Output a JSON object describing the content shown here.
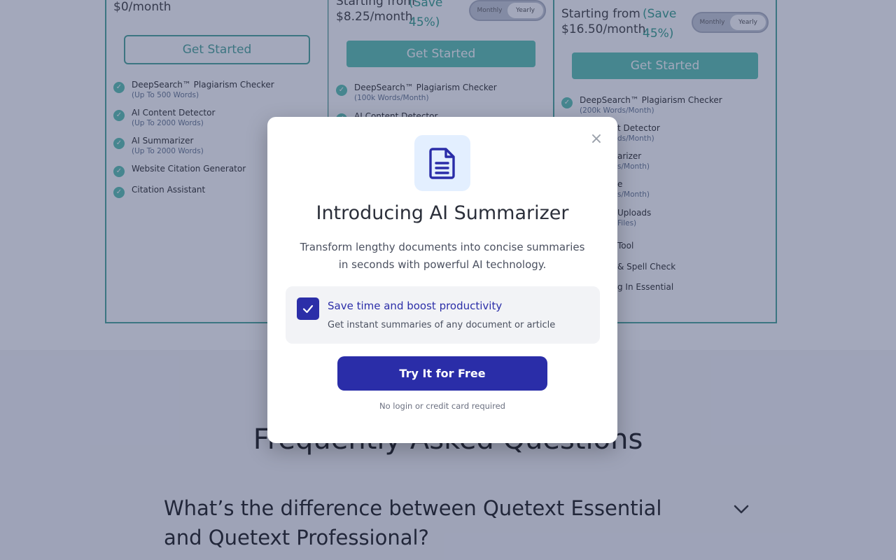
{
  "plans": [
    {
      "price": "$0/month",
      "button": "Get Started",
      "features": [
        {
          "title": "DeepSearch™ Plagiarism Checker",
          "sub": "(Up To 500 Words)"
        },
        {
          "title": "AI Content Detector",
          "sub": "(Up To 2000 Words)"
        },
        {
          "title": "AI Summarizer",
          "sub": "(Up To 2000 Words)"
        },
        {
          "title": "Website Citation Generator",
          "sub": ""
        },
        {
          "title": "Citation Assistant",
          "sub": ""
        }
      ]
    },
    {
      "price_prefix": "Starting from",
      "price": "$8.25/month",
      "save": "(Save",
      "save2": "45%)",
      "toggle": [
        "Monthly",
        "Yearly"
      ],
      "button": "Get Started",
      "features": [
        {
          "title": "DeepSearch™ Plagiarism Checker",
          "sub": "(100k Words/Month)"
        },
        {
          "title": "AI Content Detector",
          "sub": ""
        }
      ]
    },
    {
      "price_prefix": "Starting from",
      "price": "$16.50/month",
      "save": "(Save",
      "save2": "45%)",
      "toggle": [
        "Monthly",
        "Yearly"
      ],
      "button": "Get Started",
      "features": [
        {
          "title": "DeepSearch™ Plagiarism Checker",
          "sub": "(200k Words/Month)"
        },
        {
          "title": "t Detector",
          "sub": "ds/Month)"
        },
        {
          "title": "arizer",
          "sub": "s/Month)"
        },
        {
          "title": "e",
          "sub": "s/Month)"
        },
        {
          "title": "Uploads",
          "sub": "Files)"
        },
        {
          "title": "Tool",
          "sub": ""
        },
        {
          "title": "& Spell Check",
          "sub": ""
        },
        {
          "title": "g In Essential",
          "sub": ""
        }
      ]
    }
  ],
  "faq": {
    "title": "Frequently Asked Questions",
    "question": "What’s the difference between Quetext Essential and Quetext Professional?"
  },
  "modal": {
    "icon": "document-icon",
    "title": "Introducing AI Summarizer",
    "description": "Transform lengthy documents into concise summaries in seconds with powerful AI technology.",
    "benefit_title": "Save time and boost productivity",
    "benefit_sub": "Get instant summaries of any document or article",
    "cta": "Try It for Free",
    "note": "No login or credit card required",
    "close": "×"
  },
  "colors": {
    "accent": "#2a2da8",
    "teal": "#5fc4b4",
    "overlay": "rgba(36,48,94,0.42)"
  }
}
